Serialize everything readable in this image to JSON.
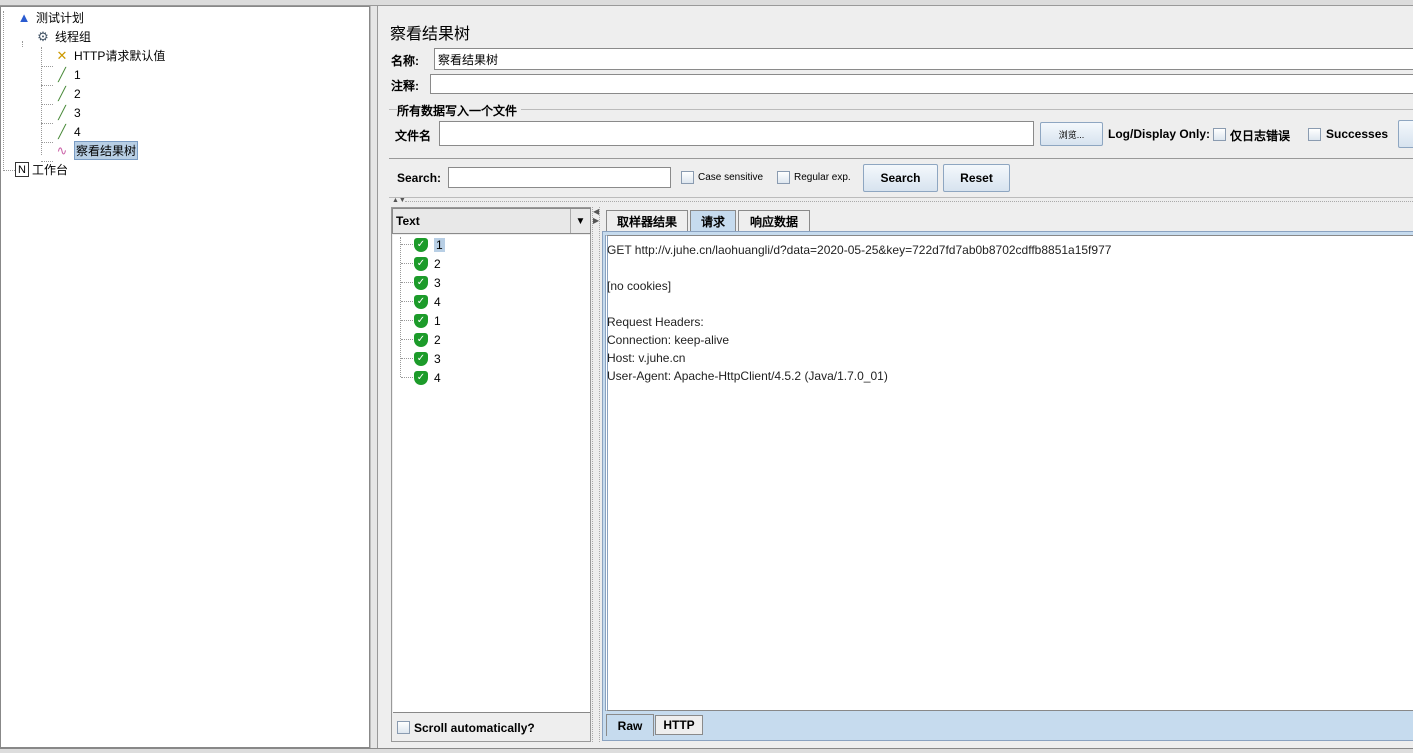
{
  "tree": {
    "items": [
      {
        "label": "测试计划",
        "icon": "test-plan-flask-icon"
      },
      {
        "label": "线程组",
        "icon": "thread-group-gear-icon"
      },
      {
        "label": "HTTP请求默认值",
        "icon": "config-wrench-icon"
      },
      {
        "label": "1",
        "icon": "sampler-pipette-icon"
      },
      {
        "label": "2",
        "icon": "sampler-pipette-icon"
      },
      {
        "label": "3",
        "icon": "sampler-pipette-icon"
      },
      {
        "label": "4",
        "icon": "sampler-pipette-icon"
      },
      {
        "label": "察看结果树",
        "icon": "listener-graph-icon",
        "selected": true
      },
      {
        "label": "工作台",
        "icon": "workbench-icon"
      }
    ]
  },
  "panel": {
    "title": "察看结果树",
    "name_label": "名称:",
    "name_value": "察看结果树",
    "comment_label": "注释:",
    "comment_value": "",
    "group_title": "所有数据写入一个文件",
    "file_label": "文件名",
    "file_value": "",
    "browse_label": "浏览...",
    "log_display_label": "Log/Display Only:",
    "errors_label": "仅日志错误",
    "successes_label": "Successes"
  },
  "search": {
    "label": "Search:",
    "value": "",
    "case_label": "Case sensitive",
    "regex_label": "Regular exp.",
    "search_button": "Search",
    "reset_button": "Reset"
  },
  "results": {
    "renderer": "Text",
    "items": [
      "1",
      "2",
      "3",
      "4",
      "1",
      "2",
      "3",
      "4"
    ],
    "scroll_label": "Scroll automatically?",
    "status_color": "#1c9b2a"
  },
  "detail": {
    "tabs": [
      "取样器结果",
      "请求",
      "响应数据"
    ],
    "active_tab": "请求",
    "lines": [
      "GET http://v.juhe.cn/laohuangli/d?data=2020-05-25&key=722d7fd7ab0b8702cdffb8851a15f977",
      "",
      "[no cookies]",
      "",
      "Request Headers:",
      "Connection: keep-alive",
      "Host: v.juhe.cn",
      "User-Agent: Apache-HttpClient/4.5.2 (Java/1.7.0_01)"
    ],
    "bottom_tabs": [
      "Raw",
      "HTTP"
    ],
    "active_bottom_tab": "Raw"
  }
}
